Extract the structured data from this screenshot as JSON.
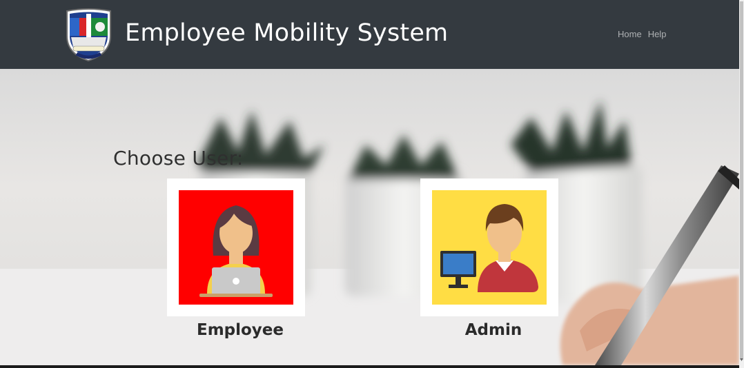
{
  "header": {
    "title": "Employee Mobility System",
    "logo_icon": "school-crest-icon"
  },
  "nav": {
    "items": [
      {
        "label": "Home"
      },
      {
        "label": "Help"
      }
    ]
  },
  "main": {
    "heading": "Choose User:",
    "cards": [
      {
        "label": "Employee",
        "icon": "female-employee-laptop-icon",
        "background": "#ff0000"
      },
      {
        "label": "Admin",
        "icon": "male-admin-computer-icon",
        "background": "#ffdd44"
      }
    ]
  },
  "colors": {
    "navbar": "#343a40",
    "title_text": "#ffffff",
    "nav_link": "#9a9da0"
  }
}
